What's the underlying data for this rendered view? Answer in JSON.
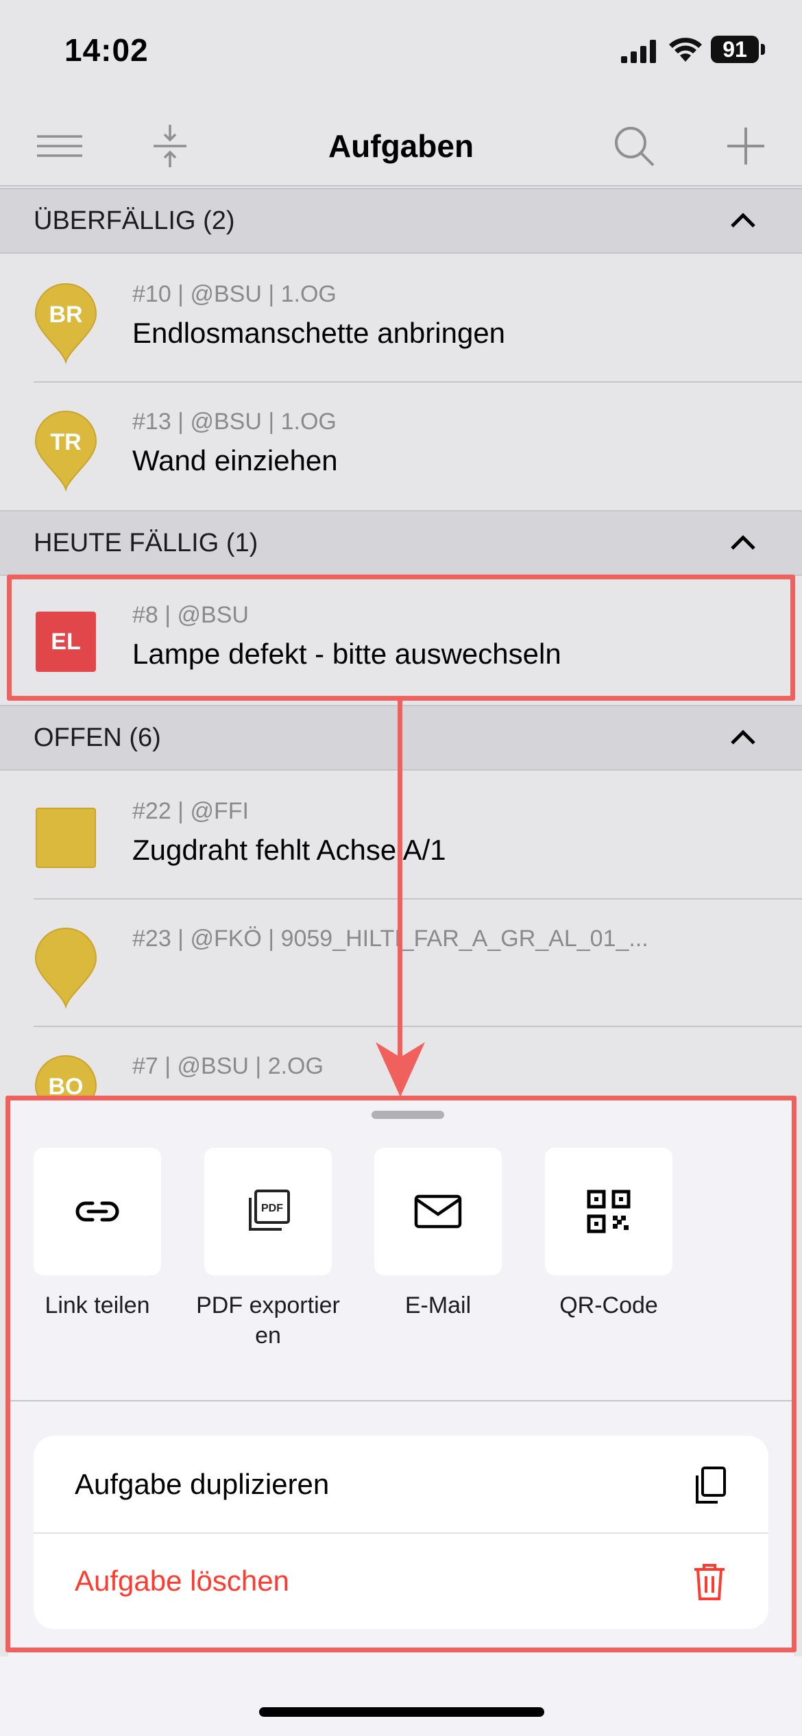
{
  "status_bar": {
    "time": "14:02",
    "battery": "91"
  },
  "nav": {
    "title": "Aufgaben"
  },
  "sections": [
    {
      "title": "ÜBERFÄLLIG (2)",
      "tasks": [
        {
          "badge": "BR",
          "meta": "#10 | @BSU | 1.OG",
          "title": "Endlosmanschette anbringen",
          "icon": "pin",
          "color": "#dbb93c"
        },
        {
          "badge": "TR",
          "meta": "#13 | @BSU | 1.OG",
          "title": "Wand einziehen",
          "icon": "pin",
          "color": "#dbb93c"
        }
      ]
    },
    {
      "title": "HEUTE FÄLLIG (1)",
      "tasks": [
        {
          "badge": "EL",
          "meta": "#8 | @BSU",
          "title": "Lampe defekt - bitte auswechseln",
          "icon": "square",
          "color": "#e0464a"
        }
      ]
    },
    {
      "title": "OFFEN (6)",
      "tasks": [
        {
          "badge": "",
          "meta": "#22 | @FFI",
          "title": "Zugdraht fehlt Achse A/1",
          "icon": "square",
          "color": "#dbb93c"
        },
        {
          "badge": "",
          "meta": "#23 | @FKÖ | 9059_HILTI_FAR_A_GR_AL_01_...",
          "title": "",
          "icon": "pin",
          "color": "#dbb93c"
        },
        {
          "badge": "BO",
          "meta": "#7 | @BSU | 2.OG",
          "title": "",
          "icon": "pin",
          "color": "#dbb93c"
        }
      ]
    }
  ],
  "sheet": {
    "share_options": [
      {
        "label": "Link teilen",
        "icon": "link-icon"
      },
      {
        "label": "PDF exportieren",
        "icon": "pdf-icon"
      },
      {
        "label": "E-Mail",
        "icon": "mail-icon"
      },
      {
        "label": "QR-Code",
        "icon": "qr-code-icon"
      }
    ],
    "actions": [
      {
        "label": "Aufgabe duplizieren",
        "icon": "duplicate-icon",
        "color": "#000000"
      },
      {
        "label": "Aufgabe löschen",
        "icon": "trash-icon",
        "color": "#ff3b30"
      }
    ]
  },
  "colors": {
    "accent_highlight": "#f0605c",
    "destructive": "#ff3b30",
    "task_yellow": "#dbb93c",
    "task_red": "#e0464a"
  }
}
